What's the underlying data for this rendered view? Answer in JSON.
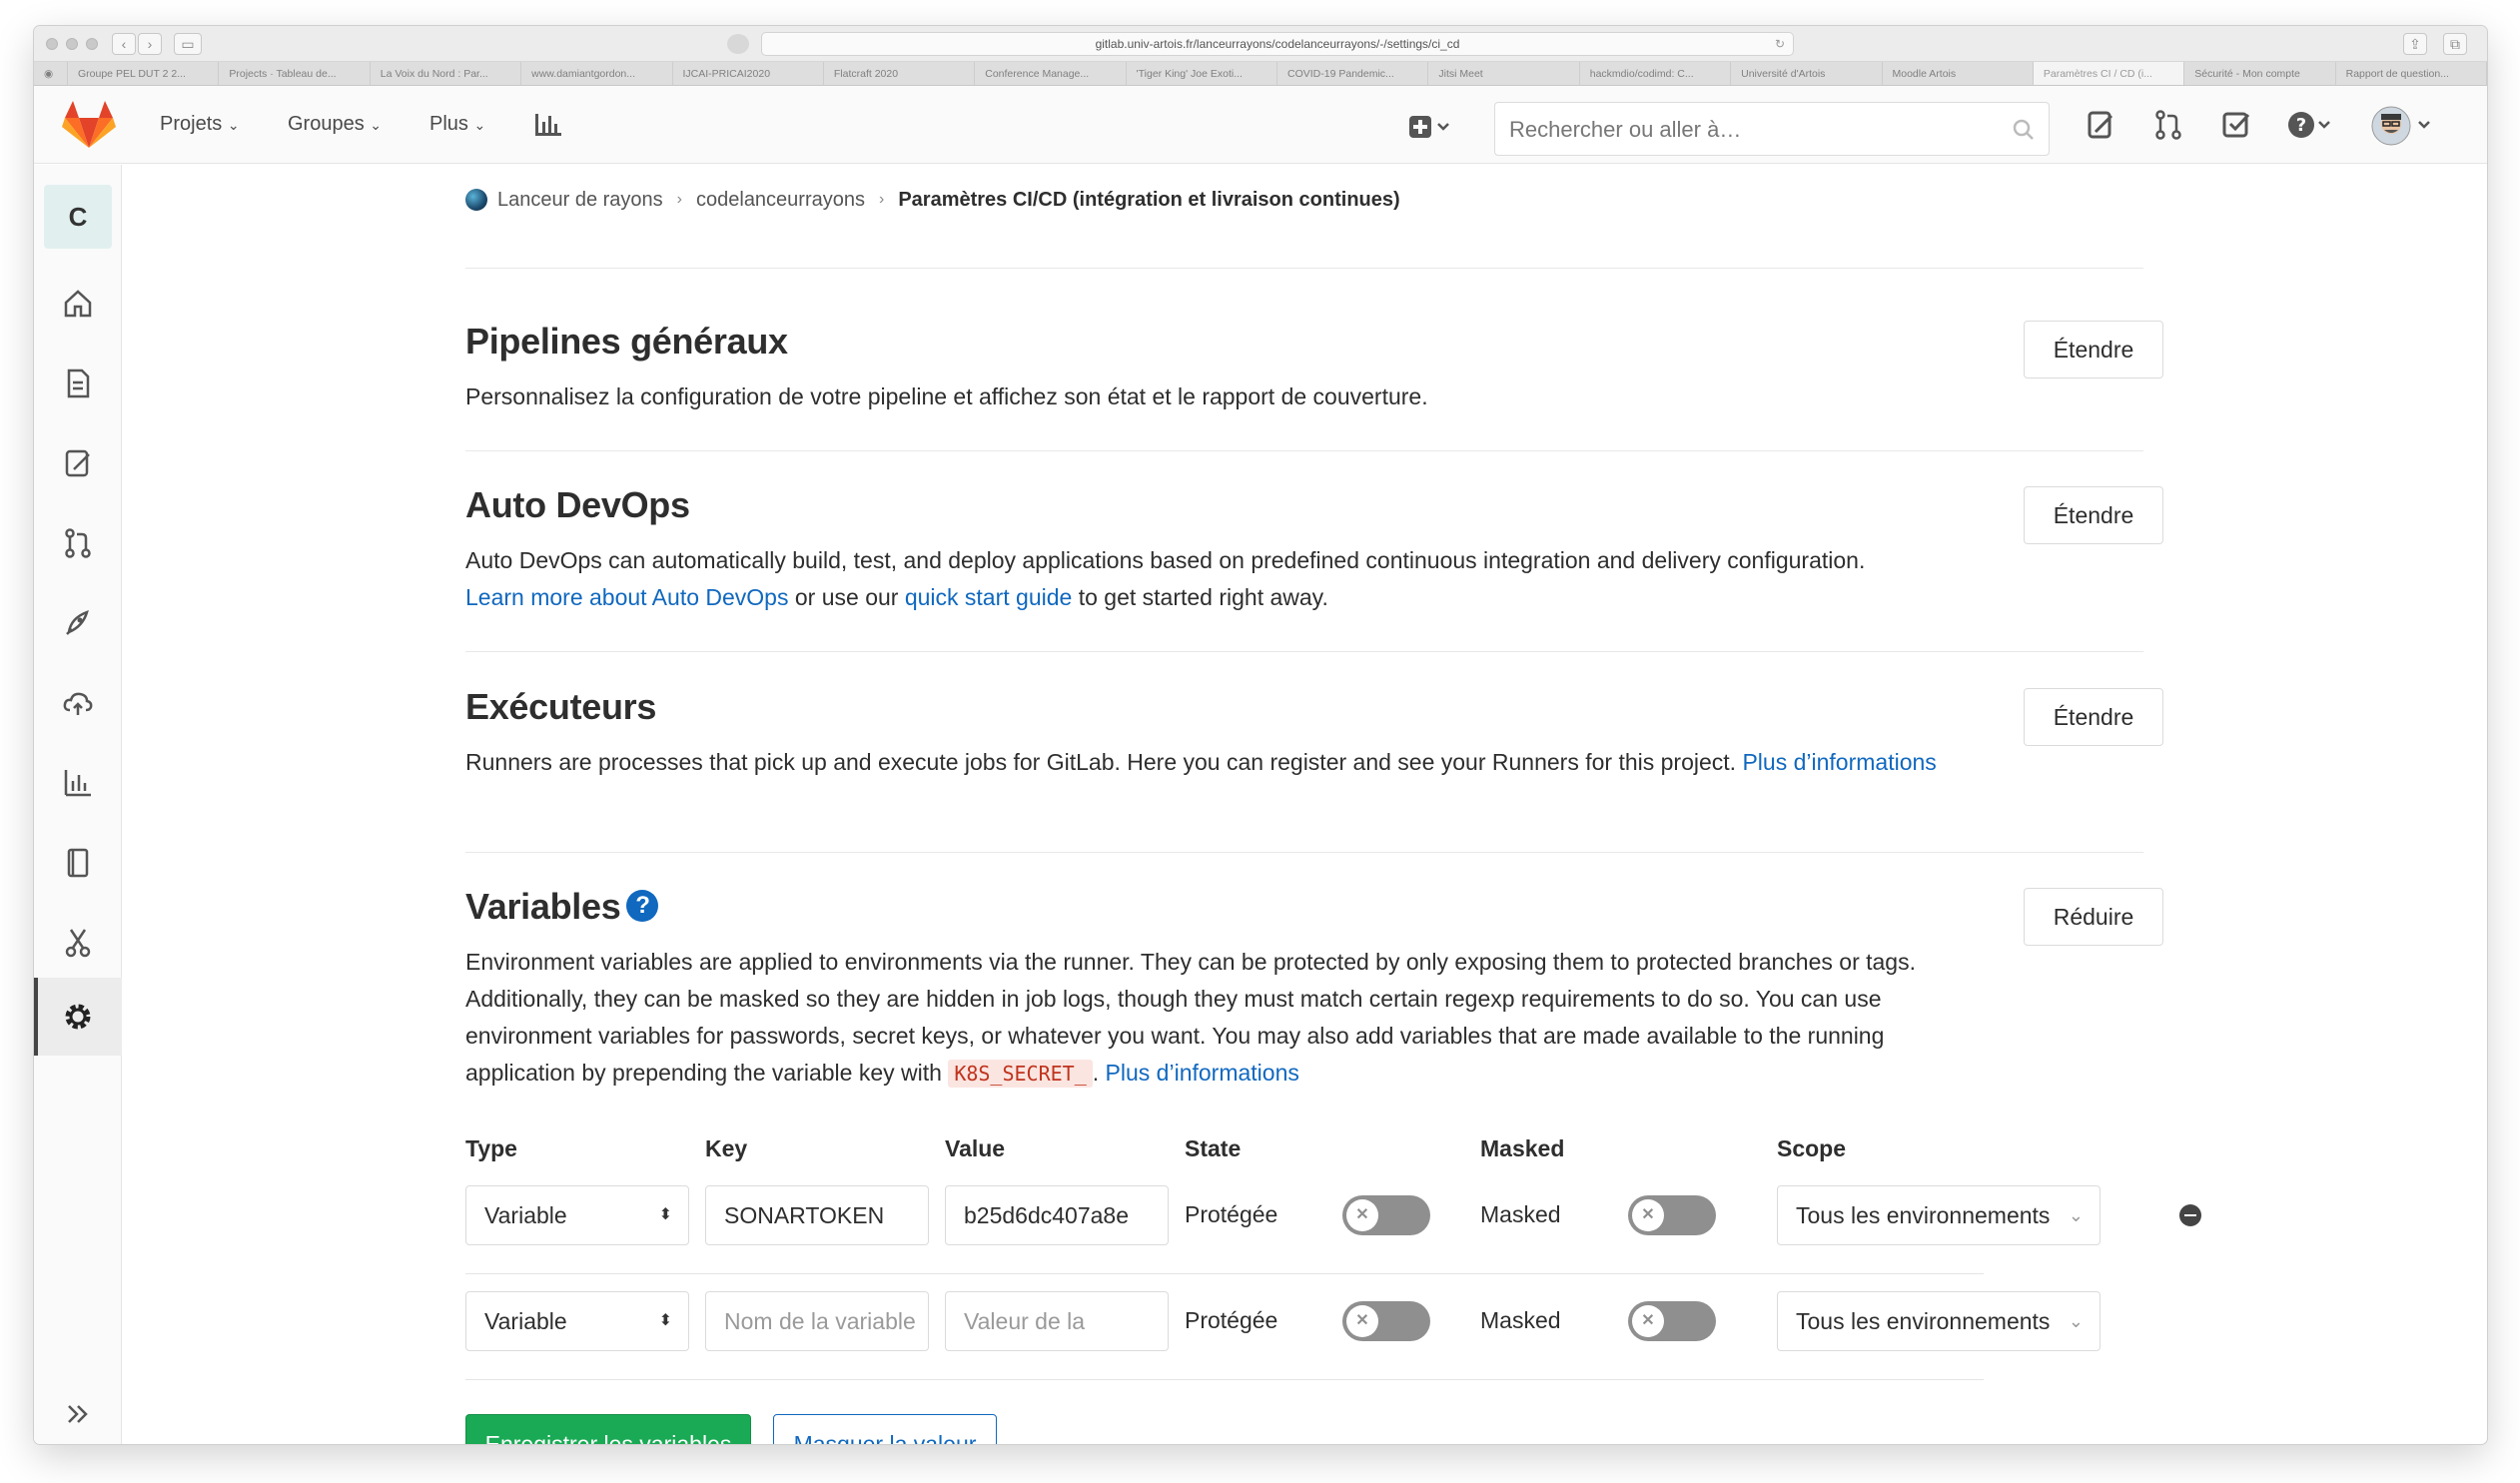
{
  "browser": {
    "url": "gitlab.univ-artois.fr/lanceurrayons/codelanceurrayons/-/settings/ci_cd",
    "tabs": [
      "Groupe PEL DUT 2 2...",
      "Projects · Tableau de...",
      "La Voix du Nord : Par...",
      "www.damiantgordon...",
      "IJCAI-PRICAI2020",
      "Flatcraft 2020",
      "Conference Manage...",
      "'Tiger King' Joe Exoti...",
      "COVID-19 Pandemic...",
      "Jitsi Meet",
      "hackmdio/codimd: C...",
      "Université d'Artois",
      "Moodle Artois",
      "Paramètres CI / CD (i...",
      "Sécurité - Mon compte",
      "Rapport de question..."
    ],
    "active_tab_index": 13
  },
  "header": {
    "nav": [
      "Projets",
      "Groupes",
      "Plus"
    ],
    "search_placeholder": "Rechercher ou aller à…"
  },
  "sidebar": {
    "project_letter": "C"
  },
  "breadcrumb": {
    "group": "Lanceur de rayons",
    "project": "codelanceurrayons",
    "current": "Paramètres CI/CD (intégration et livraison continues)"
  },
  "sections": {
    "pipelines": {
      "title": "Pipelines généraux",
      "desc": "Personnalisez la configuration de votre pipeline et affichez son état et le rapport de couverture.",
      "button": "Étendre"
    },
    "autodevops": {
      "title": "Auto DevOps",
      "desc": "Auto DevOps can automatically build, test, and deploy applications based on predefined continuous integration and delivery configuration.",
      "link1": "Learn more about Auto DevOps",
      "mid": " or use our ",
      "link2": "quick start guide",
      "end": " to get started right away.",
      "button": "Étendre"
    },
    "runners": {
      "title": "Exécuteurs",
      "desc": "Runners are processes that pick up and execute jobs for GitLab. Here you can register and see your Runners for this project. ",
      "link": "Plus d’informations",
      "button": "Étendre"
    },
    "variables": {
      "title": "Variables",
      "help": "?",
      "desc": "Environment variables are applied to environments via the runner. They can be protected by only exposing them to protected branches or tags. Additionally, they can be masked so they are hidden in job logs, though they must match certain regexp requirements to do so. You can use environment variables for passwords, secret keys, or whatever you want. You may also add variables that are made available to the running application by prepending the variable key with ",
      "code": "K8S_SECRET_",
      "desc_end": ". ",
      "link": "Plus d’informations",
      "button": "Réduire"
    }
  },
  "variables_table": {
    "headers": [
      "Type",
      "Key",
      "Value",
      "State",
      "Masked",
      "Scope"
    ],
    "rows": [
      {
        "type": "Variable",
        "key": "SONARTOKEN",
        "value": "b25d6dc407a8e",
        "state_label": "Protégée",
        "protected": false,
        "masked_label": "Masked",
        "masked": false,
        "scope": "Tous les environnements"
      },
      {
        "type": "Variable",
        "key_placeholder": "Nom de la variable",
        "value_placeholder": "Valeur de la",
        "state_label": "Protégée",
        "protected": false,
        "masked_label": "Masked",
        "masked": false,
        "scope": "Tous les environnements"
      }
    ]
  },
  "actions": {
    "save": "Enregistrer les variables",
    "mask": "Masquer la valeur"
  },
  "colors": {
    "link": "#1068bf",
    "primary_button": "#1aaa55",
    "toggle_off": "#8f8f8f",
    "code_text": "#c0341d"
  }
}
